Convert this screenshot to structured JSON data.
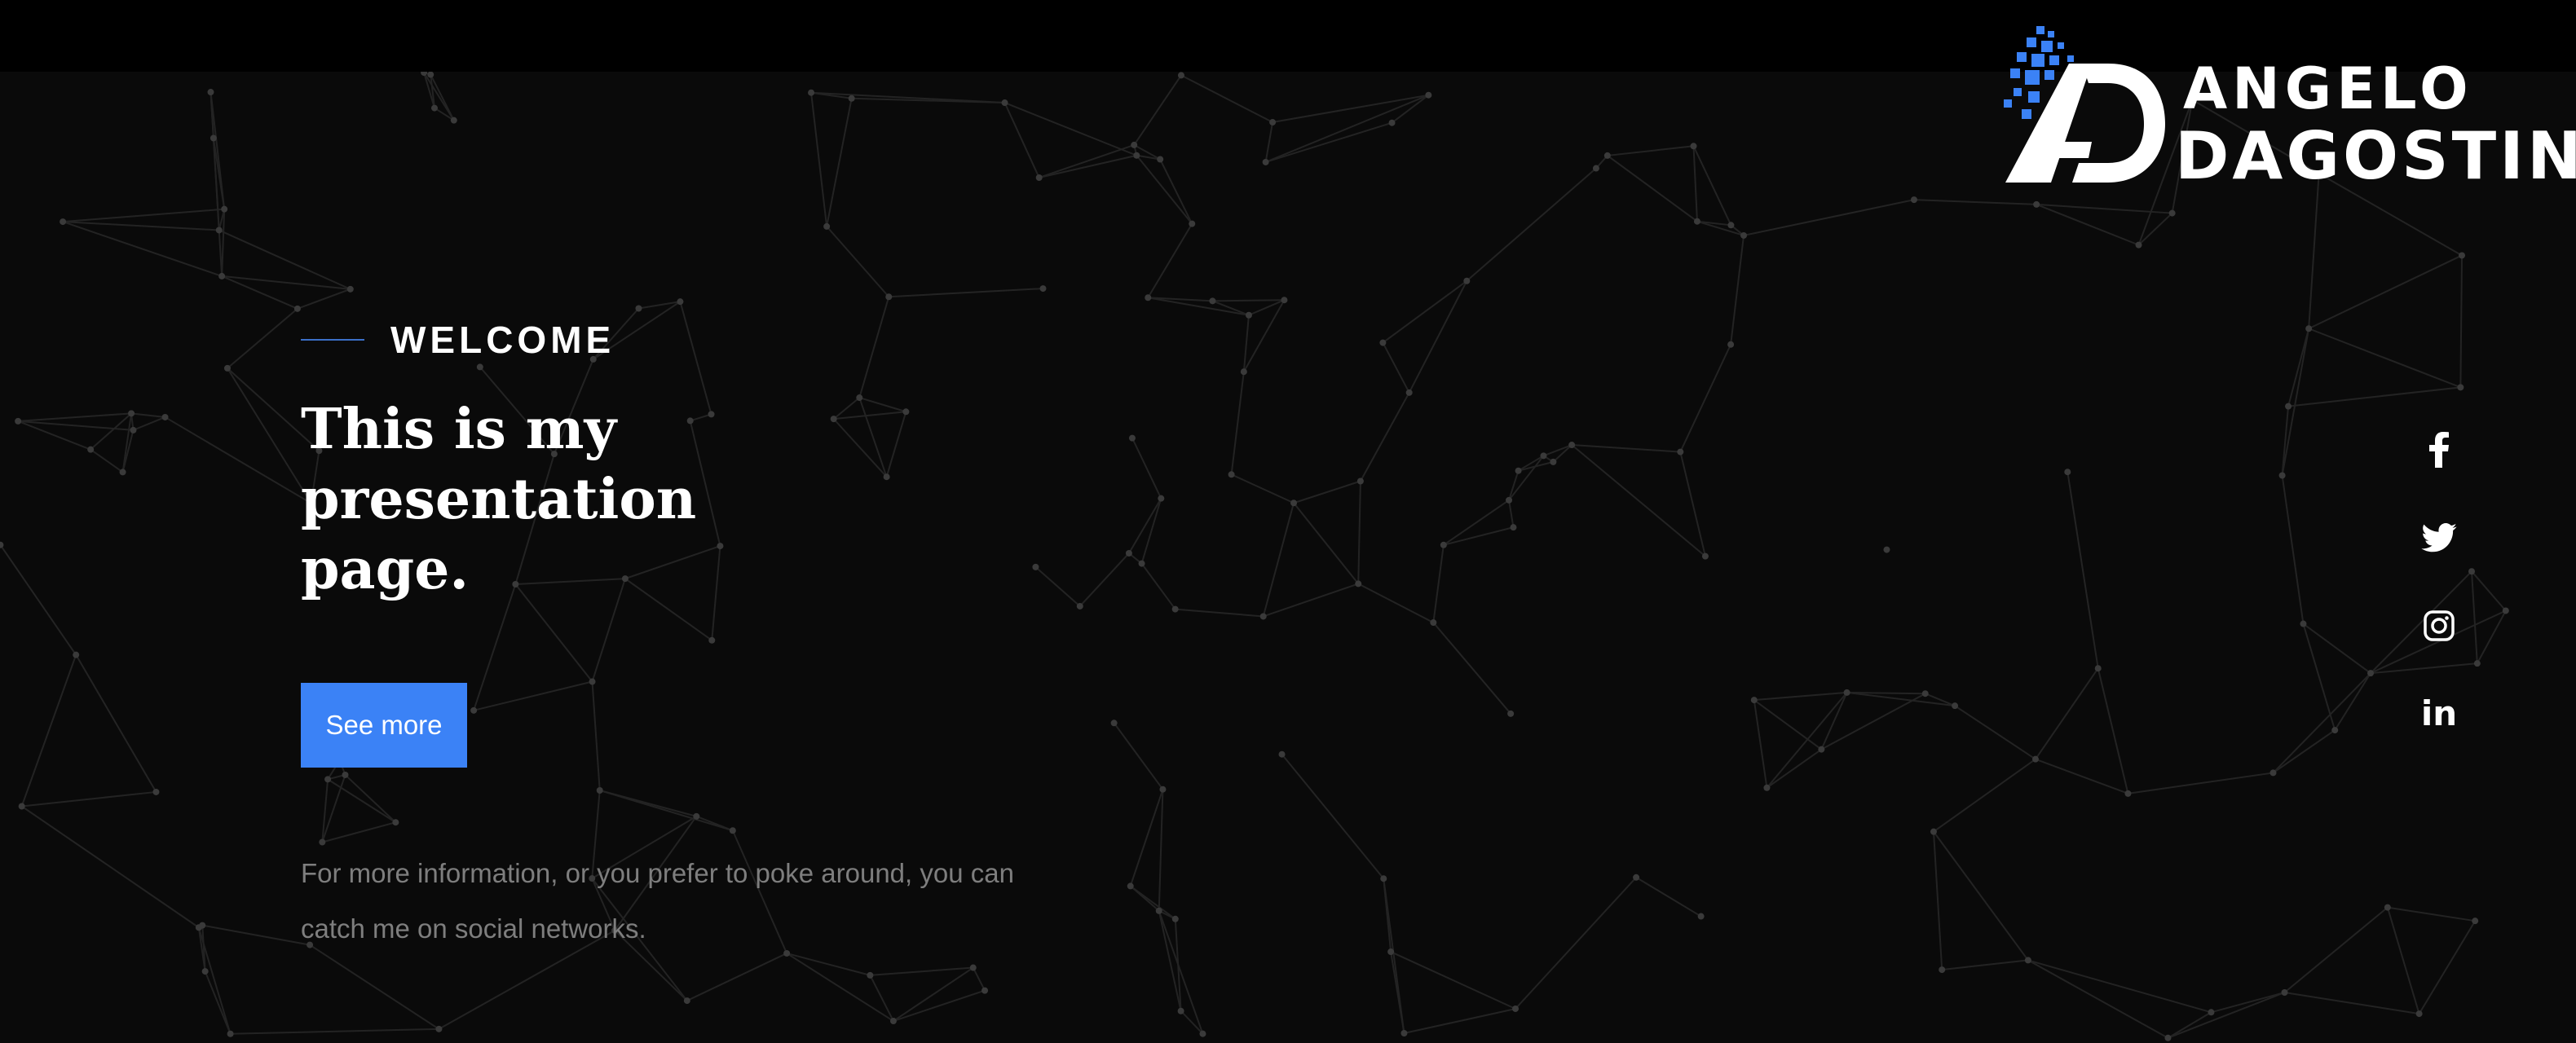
{
  "brand": {
    "line1": "ANGELO",
    "line2": "DAGOSTINO",
    "accent_color": "#3b82f6"
  },
  "hero": {
    "kicker": "WELCOME",
    "headline_line1": "This is my",
    "headline_line2": "presentation page.",
    "cta_label": "See more",
    "info_line1": "For more information, or you prefer to poke around, you can",
    "info_line2": "catch me on social networks."
  },
  "social": {
    "items": [
      {
        "name": "facebook",
        "icon": "facebook-icon"
      },
      {
        "name": "twitter",
        "icon": "twitter-icon"
      },
      {
        "name": "instagram",
        "icon": "instagram-icon"
      },
      {
        "name": "linkedin",
        "icon": "linkedin-icon",
        "glyph": "in"
      }
    ]
  },
  "colors": {
    "background": "#0a0a0a",
    "button": "#3b82f6",
    "info_text": "#7e7e7e"
  }
}
